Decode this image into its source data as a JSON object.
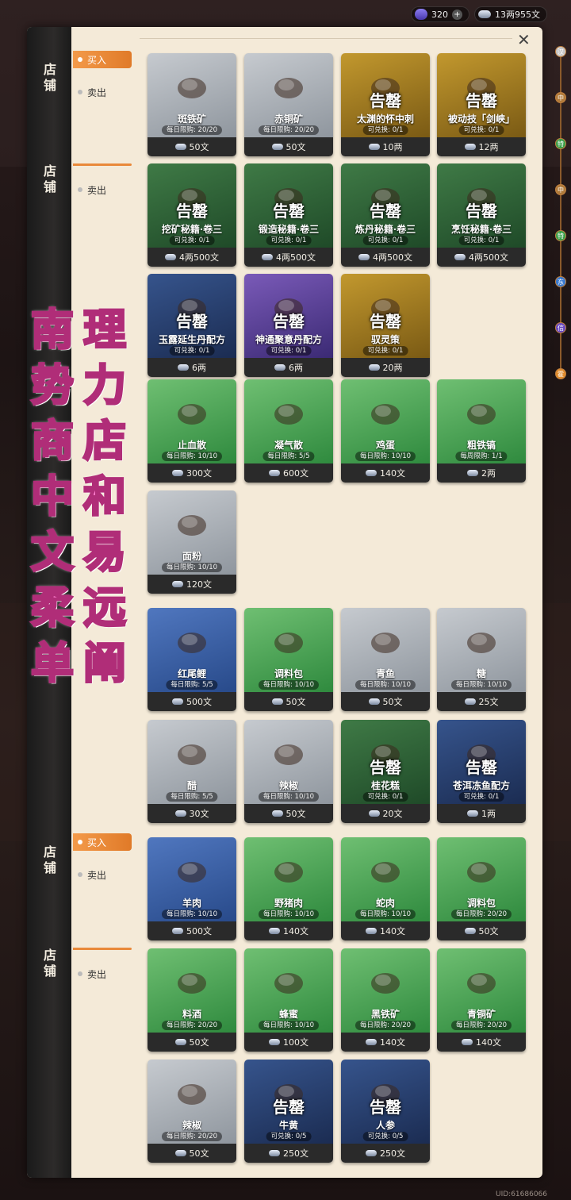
{
  "currency": {
    "gems": "320",
    "plus": "+",
    "money": "13两955文"
  },
  "close": "✕",
  "overlay_text": [
    [
      "南",
      "理"
    ],
    [
      "势",
      "力"
    ],
    [
      "商",
      "店"
    ],
    [
      "中",
      "和"
    ],
    [
      "文",
      "易"
    ],
    [
      "柔",
      "远"
    ],
    [
      "单",
      "阐"
    ]
  ],
  "sidebar": [
    {
      "tab": "店\n铺",
      "buy": "买入",
      "sell": "卖出",
      "active": "buy"
    },
    {
      "tab": "店\n铺",
      "sell": "卖出"
    },
    {
      "tab": "店\n铺",
      "buy": "买入",
      "sell": "卖出",
      "active": "buy"
    },
    {
      "tab": "店\n铺",
      "sell": "卖出"
    }
  ],
  "timeline": [
    "汉",
    "中",
    "特",
    "中",
    "特",
    "东",
    "信",
    "霍"
  ],
  "cards": [
    {
      "name": "斑铁矿",
      "limit": "每日限购: 20/20",
      "price": "50文",
      "theme": "gray"
    },
    {
      "name": "赤铜矿",
      "limit": "每日限购: 20/20",
      "price": "50文",
      "theme": "gray"
    },
    {
      "name": "太渊的怀中刺",
      "limit": "可兑换: 0/1",
      "price": "10两",
      "theme": "gold",
      "badge": "告罄"
    },
    {
      "name": "被动技「剑峡」",
      "limit": "可兑换: 0/1",
      "price": "12两",
      "theme": "gold",
      "badge": "告罄"
    },
    {
      "name": "挖矿秘籍·卷三",
      "limit": "可兑换: 0/1",
      "price": "4两500文",
      "theme": "dkgreen",
      "badge": "告罄"
    },
    {
      "name": "锻造秘籍·卷三",
      "limit": "可兑换: 0/1",
      "price": "4两500文",
      "theme": "dkgreen",
      "badge": "告罄"
    },
    {
      "name": "炼丹秘籍·卷三",
      "limit": "可兑换: 0/1",
      "price": "4两500文",
      "theme": "dkgreen",
      "badge": "告罄"
    },
    {
      "name": "烹饪秘籍·卷三",
      "limit": "可兑换: 0/1",
      "price": "4两500文",
      "theme": "dkgreen",
      "badge": "告罄"
    },
    {
      "name": "玉露延生丹配方",
      "limit": "可兑换: 0/1",
      "price": "6两",
      "theme": "navy",
      "badge": "告罄"
    },
    {
      "name": "神通聚意丹配方",
      "limit": "可兑换: 0/1",
      "price": "6两",
      "theme": "purple",
      "badge": "告罄"
    },
    {
      "name": "驭灵策",
      "limit": "可兑换: 0/1",
      "price": "20两",
      "theme": "gold",
      "badge": "告罄"
    },
    {
      "name": "止血散",
      "limit": "每日限购: 10/10",
      "price": "300文",
      "theme": "green"
    },
    {
      "name": "凝气散",
      "limit": "每日限购: 5/5",
      "price": "600文",
      "theme": "green"
    },
    {
      "name": "鸡蛋",
      "limit": "每日限购: 10/10",
      "price": "140文",
      "theme": "green"
    },
    {
      "name": "粗铁镐",
      "limit": "每周限购: 1/1",
      "price": "2两",
      "theme": "green"
    },
    {
      "name": "面粉",
      "limit": "每日限购: 10/10",
      "price": "120文",
      "theme": "gray"
    },
    {
      "name": "红尾鲤",
      "limit": "每日限购: 5/5",
      "price": "500文",
      "theme": "blue"
    },
    {
      "name": "调料包",
      "limit": "每日限购: 10/10",
      "price": "50文",
      "theme": "green"
    },
    {
      "name": "青鱼",
      "limit": "每日限购: 10/10",
      "price": "50文",
      "theme": "gray"
    },
    {
      "name": "糖",
      "limit": "每日限购: 10/10",
      "price": "25文",
      "theme": "gray"
    },
    {
      "name": "醋",
      "limit": "每日限购: 5/5",
      "price": "30文",
      "theme": "gray"
    },
    {
      "name": "辣椒",
      "limit": "每日限购: 10/10",
      "price": "50文",
      "theme": "gray"
    },
    {
      "name": "桂花糕",
      "limit": "可兑换: 0/1",
      "price": "20文",
      "theme": "dkgreen",
      "badge": "告罄"
    },
    {
      "name": "苍洱冻鱼配方",
      "limit": "可兑换: 0/1",
      "price": "1两",
      "theme": "navy",
      "badge": "告罄"
    },
    {
      "name": "羊肉",
      "limit": "每日限购: 10/10",
      "price": "500文",
      "theme": "blue"
    },
    {
      "name": "野猪肉",
      "limit": "每日限购: 10/10",
      "price": "140文",
      "theme": "green"
    },
    {
      "name": "蛇肉",
      "limit": "每日限购: 10/10",
      "price": "140文",
      "theme": "green"
    },
    {
      "name": "调料包",
      "limit": "每日限购: 20/20",
      "price": "50文",
      "theme": "green"
    },
    {
      "name": "料酒",
      "limit": "每日限购: 20/20",
      "price": "50文",
      "theme": "green"
    },
    {
      "name": "蜂蜜",
      "limit": "每日限购: 10/10",
      "price": "100文",
      "theme": "green"
    },
    {
      "name": "黑铁矿",
      "limit": "每日限购: 20/20",
      "price": "140文",
      "theme": "green"
    },
    {
      "name": "青铜矿",
      "limit": "每日限购: 20/20",
      "price": "140文",
      "theme": "green"
    },
    {
      "name": "辣椒",
      "limit": "每日限购: 20/20",
      "price": "50文",
      "theme": "gray"
    },
    {
      "name": "牛黄",
      "limit": "可兑换: 0/5",
      "price": "250文",
      "theme": "navy",
      "badge": "告罄"
    },
    {
      "name": "人参",
      "limit": "可兑换: 0/5",
      "price": "250文",
      "theme": "navy",
      "badge": "告罄"
    }
  ],
  "uid": "UID:61686066"
}
